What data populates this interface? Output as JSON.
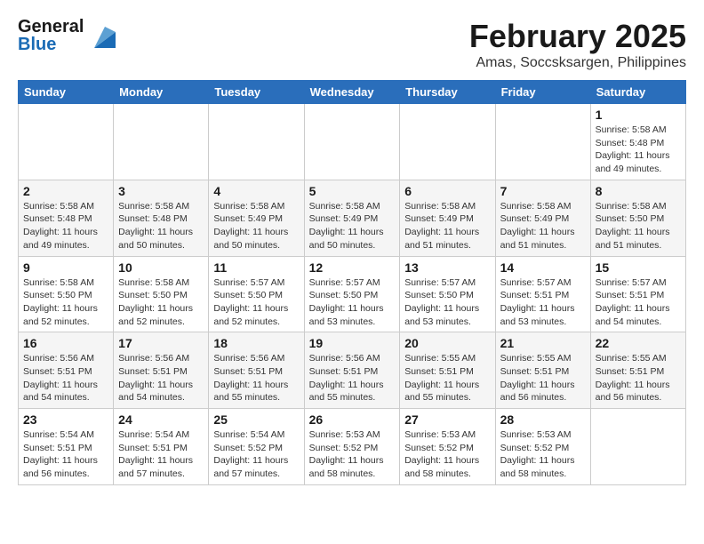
{
  "header": {
    "logo_line1": "General",
    "logo_line2": "Blue",
    "month": "February 2025",
    "location": "Amas, Soccsksargen, Philippines"
  },
  "weekdays": [
    "Sunday",
    "Monday",
    "Tuesday",
    "Wednesday",
    "Thursday",
    "Friday",
    "Saturday"
  ],
  "weeks": [
    [
      {
        "day": "",
        "info": ""
      },
      {
        "day": "",
        "info": ""
      },
      {
        "day": "",
        "info": ""
      },
      {
        "day": "",
        "info": ""
      },
      {
        "day": "",
        "info": ""
      },
      {
        "day": "",
        "info": ""
      },
      {
        "day": "1",
        "info": "Sunrise: 5:58 AM\nSunset: 5:48 PM\nDaylight: 11 hours\nand 49 minutes."
      }
    ],
    [
      {
        "day": "2",
        "info": "Sunrise: 5:58 AM\nSunset: 5:48 PM\nDaylight: 11 hours\nand 49 minutes."
      },
      {
        "day": "3",
        "info": "Sunrise: 5:58 AM\nSunset: 5:48 PM\nDaylight: 11 hours\nand 50 minutes."
      },
      {
        "day": "4",
        "info": "Sunrise: 5:58 AM\nSunset: 5:49 PM\nDaylight: 11 hours\nand 50 minutes."
      },
      {
        "day": "5",
        "info": "Sunrise: 5:58 AM\nSunset: 5:49 PM\nDaylight: 11 hours\nand 50 minutes."
      },
      {
        "day": "6",
        "info": "Sunrise: 5:58 AM\nSunset: 5:49 PM\nDaylight: 11 hours\nand 51 minutes."
      },
      {
        "day": "7",
        "info": "Sunrise: 5:58 AM\nSunset: 5:49 PM\nDaylight: 11 hours\nand 51 minutes."
      },
      {
        "day": "8",
        "info": "Sunrise: 5:58 AM\nSunset: 5:50 PM\nDaylight: 11 hours\nand 51 minutes."
      }
    ],
    [
      {
        "day": "9",
        "info": "Sunrise: 5:58 AM\nSunset: 5:50 PM\nDaylight: 11 hours\nand 52 minutes."
      },
      {
        "day": "10",
        "info": "Sunrise: 5:58 AM\nSunset: 5:50 PM\nDaylight: 11 hours\nand 52 minutes."
      },
      {
        "day": "11",
        "info": "Sunrise: 5:57 AM\nSunset: 5:50 PM\nDaylight: 11 hours\nand 52 minutes."
      },
      {
        "day": "12",
        "info": "Sunrise: 5:57 AM\nSunset: 5:50 PM\nDaylight: 11 hours\nand 53 minutes."
      },
      {
        "day": "13",
        "info": "Sunrise: 5:57 AM\nSunset: 5:50 PM\nDaylight: 11 hours\nand 53 minutes."
      },
      {
        "day": "14",
        "info": "Sunrise: 5:57 AM\nSunset: 5:51 PM\nDaylight: 11 hours\nand 53 minutes."
      },
      {
        "day": "15",
        "info": "Sunrise: 5:57 AM\nSunset: 5:51 PM\nDaylight: 11 hours\nand 54 minutes."
      }
    ],
    [
      {
        "day": "16",
        "info": "Sunrise: 5:56 AM\nSunset: 5:51 PM\nDaylight: 11 hours\nand 54 minutes."
      },
      {
        "day": "17",
        "info": "Sunrise: 5:56 AM\nSunset: 5:51 PM\nDaylight: 11 hours\nand 54 minutes."
      },
      {
        "day": "18",
        "info": "Sunrise: 5:56 AM\nSunset: 5:51 PM\nDaylight: 11 hours\nand 55 minutes."
      },
      {
        "day": "19",
        "info": "Sunrise: 5:56 AM\nSunset: 5:51 PM\nDaylight: 11 hours\nand 55 minutes."
      },
      {
        "day": "20",
        "info": "Sunrise: 5:55 AM\nSunset: 5:51 PM\nDaylight: 11 hours\nand 55 minutes."
      },
      {
        "day": "21",
        "info": "Sunrise: 5:55 AM\nSunset: 5:51 PM\nDaylight: 11 hours\nand 56 minutes."
      },
      {
        "day": "22",
        "info": "Sunrise: 5:55 AM\nSunset: 5:51 PM\nDaylight: 11 hours\nand 56 minutes."
      }
    ],
    [
      {
        "day": "23",
        "info": "Sunrise: 5:54 AM\nSunset: 5:51 PM\nDaylight: 11 hours\nand 56 minutes."
      },
      {
        "day": "24",
        "info": "Sunrise: 5:54 AM\nSunset: 5:51 PM\nDaylight: 11 hours\nand 57 minutes."
      },
      {
        "day": "25",
        "info": "Sunrise: 5:54 AM\nSunset: 5:52 PM\nDaylight: 11 hours\nand 57 minutes."
      },
      {
        "day": "26",
        "info": "Sunrise: 5:53 AM\nSunset: 5:52 PM\nDaylight: 11 hours\nand 58 minutes."
      },
      {
        "day": "27",
        "info": "Sunrise: 5:53 AM\nSunset: 5:52 PM\nDaylight: 11 hours\nand 58 minutes."
      },
      {
        "day": "28",
        "info": "Sunrise: 5:53 AM\nSunset: 5:52 PM\nDaylight: 11 hours\nand 58 minutes."
      },
      {
        "day": "",
        "info": ""
      }
    ]
  ]
}
